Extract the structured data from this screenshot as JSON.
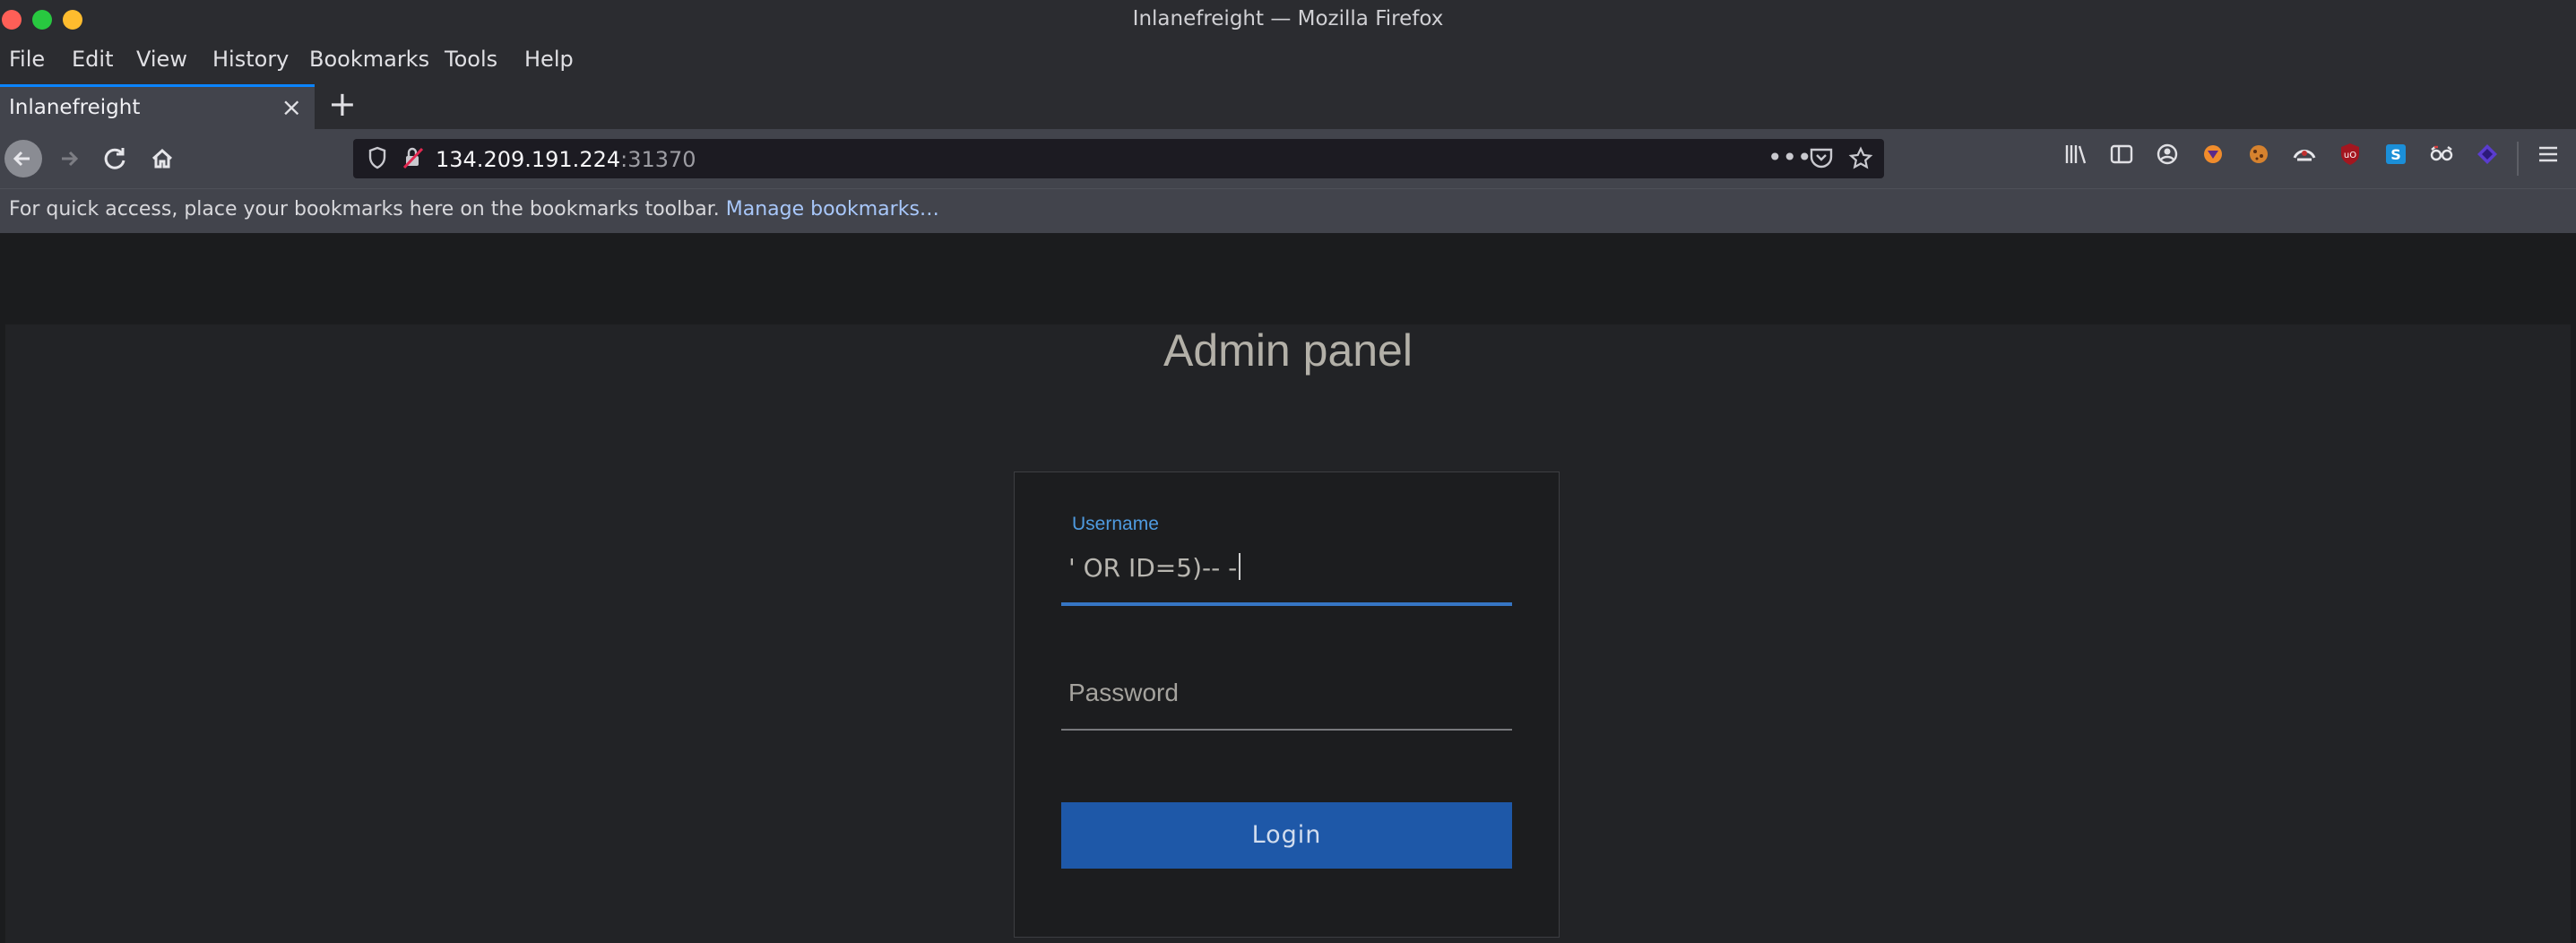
{
  "window": {
    "title": "Inlanefreight — Mozilla Firefox",
    "controls": {
      "close_color": "#ff5f57",
      "minimize_color": "#28c840",
      "maximize_color": "#febc2e"
    }
  },
  "menubar": {
    "items": [
      "File",
      "Edit",
      "View",
      "History",
      "Bookmarks",
      "Tools",
      "Help"
    ]
  },
  "tabs": [
    {
      "label": "Inlanefreight",
      "active": true
    }
  ],
  "toolbar": {
    "url_host": "134.209.191.224",
    "url_port": ":31370",
    "icons": [
      "library-icon",
      "sidebar-icon",
      "account-icon",
      "extension-fox-icon",
      "extension-cookie-icon",
      "extension-wappalyzer-icon",
      "ublock-origin-icon",
      "extension-s-icon",
      "extension-glasses-icon",
      "extension-purple-icon",
      "menu-icon"
    ]
  },
  "bookmarks_bar": {
    "text": "For quick access, place your bookmarks here on the bookmarks toolbar.",
    "link": "Manage bookmarks…"
  },
  "page": {
    "title": "Admin panel",
    "form": {
      "username_label": "Username",
      "username_value": "' OR ID=5)-- -",
      "password_placeholder": "Password",
      "login_label": "Login"
    }
  },
  "colors": {
    "accent": "#0a84ff",
    "button": "#1e58a8",
    "focus_line": "#3676c4"
  }
}
